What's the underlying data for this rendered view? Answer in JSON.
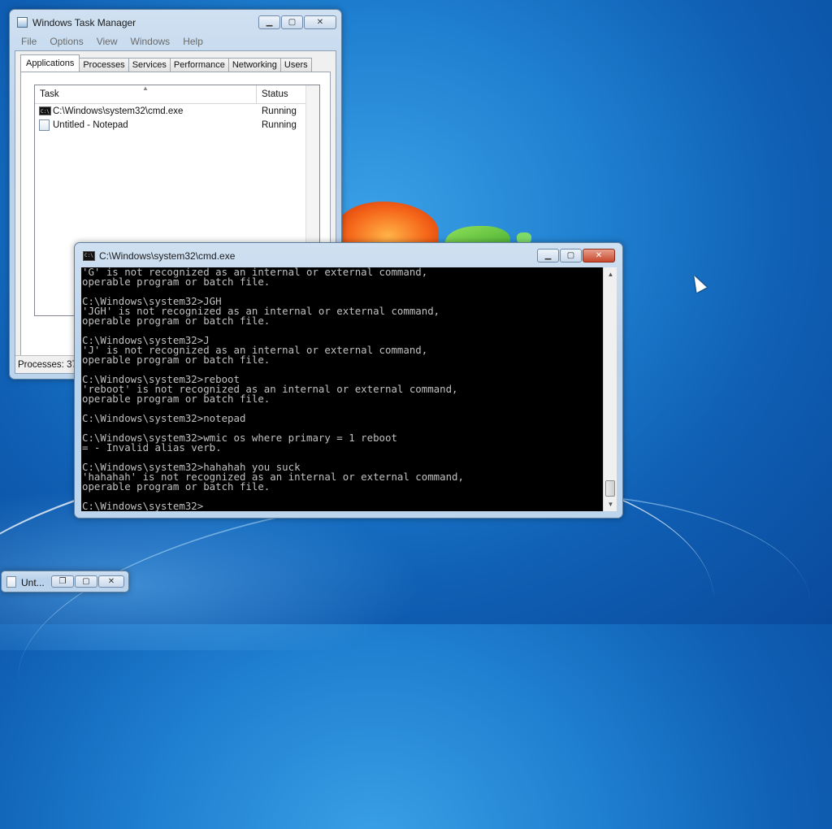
{
  "task_manager": {
    "title": "Windows Task Manager",
    "menu": [
      "File",
      "Options",
      "View",
      "Windows",
      "Help"
    ],
    "tabs": [
      "Applications",
      "Processes",
      "Services",
      "Performance",
      "Networking",
      "Users"
    ],
    "active_tab": "Applications",
    "columns": [
      "Task",
      "Status"
    ],
    "tasks": [
      {
        "name": "C:\\Windows\\system32\\cmd.exe",
        "status": "Running",
        "icon": "cmd-icon"
      },
      {
        "name": "Untitled - Notepad",
        "status": "Running",
        "icon": "notepad-icon"
      }
    ],
    "status_bar": "Processes: 37"
  },
  "cmd": {
    "title": "C:\\Windows\\system32\\cmd.exe",
    "lines": [
      "'G' is not recognized as an internal or external command,",
      "operable program or batch file.",
      "",
      "C:\\Windows\\system32>JGH",
      "'JGH' is not recognized as an internal or external command,",
      "operable program or batch file.",
      "",
      "C:\\Windows\\system32>J",
      "'J' is not recognized as an internal or external command,",
      "operable program or batch file.",
      "",
      "C:\\Windows\\system32>reboot",
      "'reboot' is not recognized as an internal or external command,",
      "operable program or batch file.",
      "",
      "C:\\Windows\\system32>notepad",
      "",
      "C:\\Windows\\system32>wmic os where primary = 1 reboot",
      "= - Invalid alias verb.",
      "",
      "C:\\Windows\\system32>hahahah you suck",
      "'hahahah' is not recognized as an internal or external command,",
      "operable program or batch file.",
      "",
      "C:\\Windows\\system32>"
    ],
    "icon_text": "C:\\"
  },
  "minimized_notepad": {
    "title": "Unt..."
  }
}
